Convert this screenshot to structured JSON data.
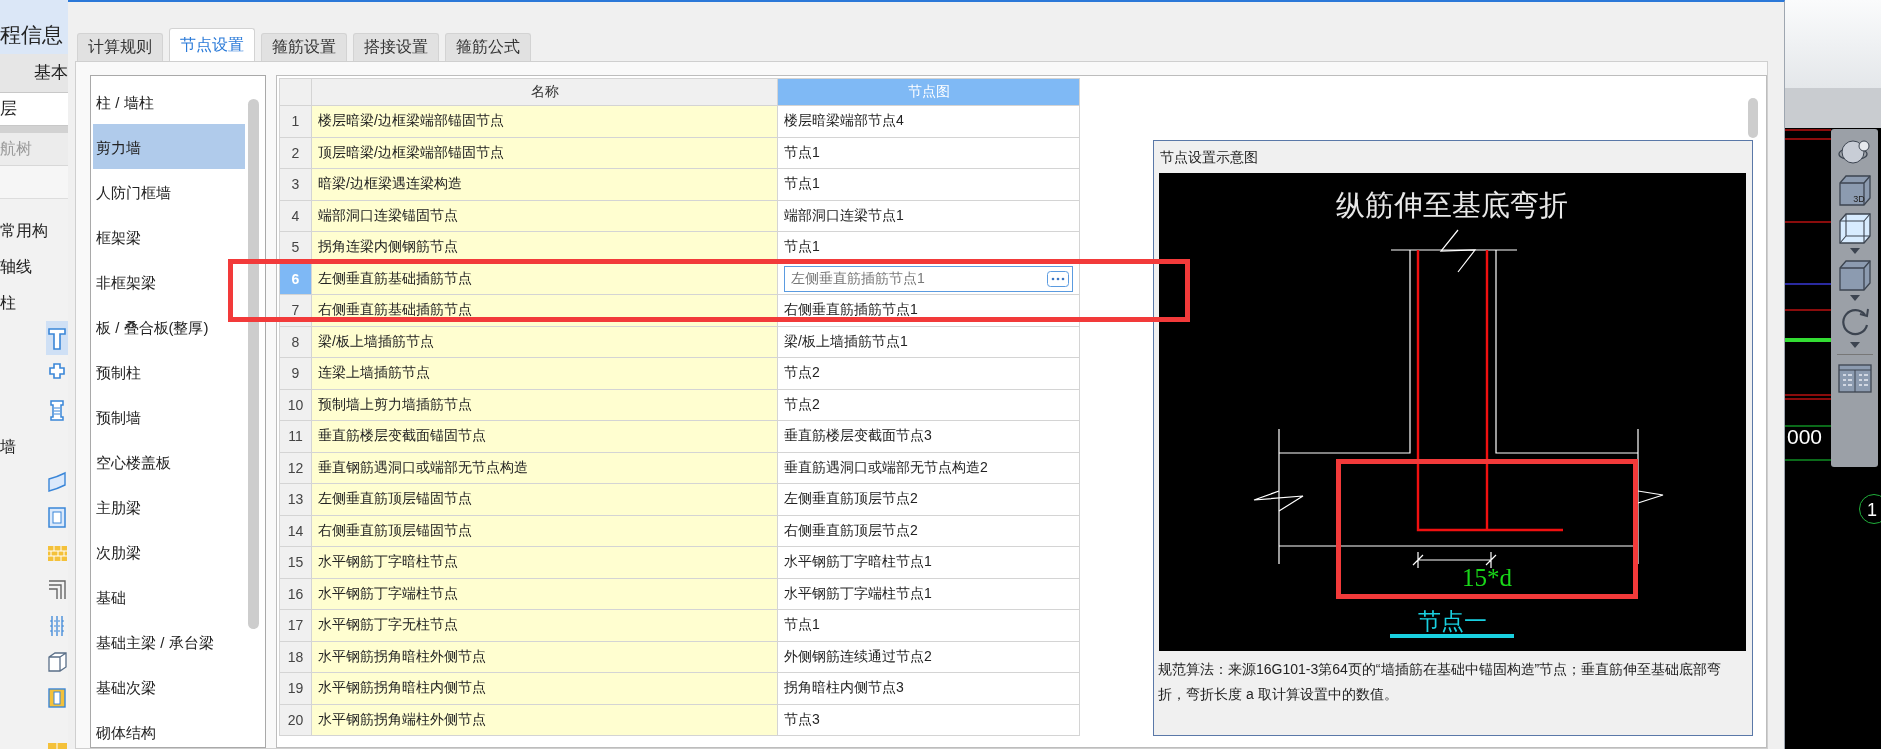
{
  "sidebar": {
    "title": "程信息",
    "tab": "基本",
    "field_value": "层",
    "tree_label": "航树",
    "tree": [
      {
        "label": "常用构"
      },
      {
        "label": "轴线"
      },
      {
        "label": "柱",
        "children": [
          {
            "kind": "tshape",
            "selected": true
          },
          {
            "kind": "cross",
            "selected": false
          },
          {
            "kind": "pillar",
            "selected": false
          }
        ]
      },
      {
        "label": "墙",
        "children": [
          {
            "kind": "curved",
            "selected": false
          },
          {
            "kind": "square",
            "selected": false
          },
          {
            "kind": "brick",
            "selected": false
          },
          {
            "kind": "corner",
            "selected": false
          },
          {
            "kind": "grid",
            "selected": false
          },
          {
            "kind": "box",
            "selected": false
          },
          {
            "kind": "yellowbox",
            "selected": false
          },
          {
            "kind": "slab",
            "selected": false
          }
        ]
      }
    ]
  },
  "dialog": {
    "tabs": [
      {
        "label": "计算规则",
        "selected": false
      },
      {
        "label": "节点设置",
        "selected": true
      },
      {
        "label": "箍筋设置",
        "selected": false
      },
      {
        "label": "搭接设置",
        "selected": false
      },
      {
        "label": "箍筋公式",
        "selected": false
      }
    ],
    "categories": [
      {
        "label": "柱 / 墙柱",
        "selected": false
      },
      {
        "label": "剪力墙",
        "selected": true
      },
      {
        "label": "人防门框墙",
        "selected": false
      },
      {
        "label": "框架梁",
        "selected": false
      },
      {
        "label": "非框架梁",
        "selected": false
      },
      {
        "label": "板 / 叠合板(整厚)",
        "selected": false
      },
      {
        "label": "预制柱",
        "selected": false
      },
      {
        "label": "预制墙",
        "selected": false
      },
      {
        "label": "空心楼盖板",
        "selected": false
      },
      {
        "label": "主肋梁",
        "selected": false
      },
      {
        "label": "次肋梁",
        "selected": false
      },
      {
        "label": "基础",
        "selected": false
      },
      {
        "label": "基础主梁 / 承台梁",
        "selected": false
      },
      {
        "label": "基础次梁",
        "selected": false
      },
      {
        "label": "砌体结构",
        "selected": false
      }
    ],
    "table": {
      "columns": [
        {
          "label": "名称",
          "selected": false
        },
        {
          "label": "节点图",
          "selected": true
        }
      ],
      "rows": [
        {
          "index": "1",
          "name": "楼层暗梁/边框梁端部锚固节点",
          "node": "楼层暗梁端部节点4",
          "selected": false
        },
        {
          "index": "2",
          "name": "顶层暗梁/边框梁端部锚固节点",
          "node": "节点1",
          "selected": false
        },
        {
          "index": "3",
          "name": "暗梁/边框梁遇连梁构造",
          "node": "节点1",
          "selected": false
        },
        {
          "index": "4",
          "name": "端部洞口连梁锚固节点",
          "node": "端部洞口连梁节点1",
          "selected": false
        },
        {
          "index": "5",
          "name": "拐角连梁内侧钢筋节点",
          "node": "节点1",
          "selected": false
        },
        {
          "index": "6",
          "name": "左侧垂直筋基础插筋节点",
          "node": "左侧垂直筋插筋节点1",
          "selected": true
        },
        {
          "index": "7",
          "name": "右侧垂直筋基础插筋节点",
          "node": "右侧垂直筋插筋节点1",
          "selected": false
        },
        {
          "index": "8",
          "name": "梁/板上墙插筋节点",
          "node": "梁/板上墙插筋节点1",
          "selected": false
        },
        {
          "index": "9",
          "name": "连梁上墙插筋节点",
          "node": "节点2",
          "selected": false
        },
        {
          "index": "10",
          "name": "预制墙上剪力墙插筋节点",
          "node": "节点2",
          "selected": false
        },
        {
          "index": "11",
          "name": "垂直筋楼层变截面锚固节点",
          "node": "垂直筋楼层变截面节点3",
          "selected": false
        },
        {
          "index": "12",
          "name": "垂直钢筋遇洞口或端部无节点构造",
          "node": "垂直筋遇洞口或端部无节点构造2",
          "selected": false
        },
        {
          "index": "13",
          "name": "左侧垂直筋顶层锚固节点",
          "node": "左侧垂直筋顶层节点2",
          "selected": false
        },
        {
          "index": "14",
          "name": "右侧垂直筋顶层锚固节点",
          "node": "右侧垂直筋顶层节点2",
          "selected": false
        },
        {
          "index": "15",
          "name": "水平钢筋丁字暗柱节点",
          "node": "水平钢筋丁字暗柱节点1",
          "selected": false
        },
        {
          "index": "16",
          "name": "水平钢筋丁字端柱节点",
          "node": "水平钢筋丁字端柱节点1",
          "selected": false
        },
        {
          "index": "17",
          "name": "水平钢筋丁字无柱节点",
          "node": "节点1",
          "selected": false
        },
        {
          "index": "18",
          "name": "水平钢筋拐角暗柱外侧节点",
          "node": "外侧钢筋连续通过节点2",
          "selected": false
        },
        {
          "index": "19",
          "name": "水平钢筋拐角暗柱内侧节点",
          "node": "拐角暗柱内侧节点3",
          "selected": false
        },
        {
          "index": "20",
          "name": "水平钢筋拐角端柱外侧节点",
          "node": "节点3",
          "selected": false
        }
      ]
    },
    "preview": {
      "title": "节点设置示意图",
      "heading": "纵筋伸至基底弯折",
      "dimension": "15*d",
      "caption": "节点一",
      "description": "规范算法：来源16G101-3第64页的“墙插筋在基础中锚固构造”节点；垂直筋伸至基础底部弯折，弯折长度 a 取计算设置中的数值。"
    }
  },
  "canvas": {
    "cube_label": "3D",
    "elevation": "000",
    "axis_marker": "1"
  }
}
